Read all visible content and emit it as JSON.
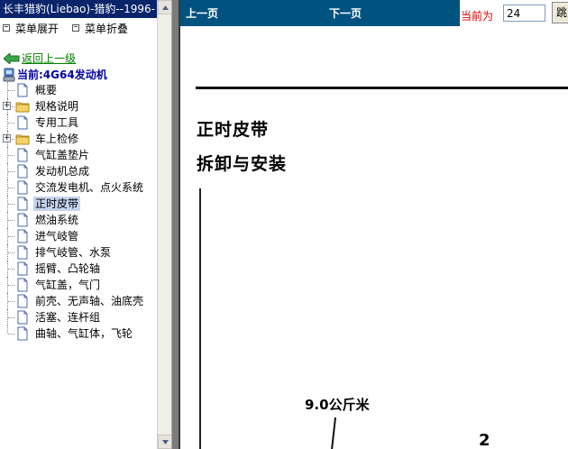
{
  "left": {
    "title": "长丰猎豹(Liebao)-猎豹--1996-",
    "menu_expand": "菜单展开",
    "menu_collapse": "菜单折叠",
    "back_link": "返回上一级",
    "root_label": "当前:4G64发动机",
    "tree": [
      {
        "label": "概要",
        "icon": "page-icon"
      },
      {
        "label": "规格说明",
        "icon": "folder-icon",
        "expandable": true
      },
      {
        "label": "专用工具",
        "icon": "page-icon"
      },
      {
        "label": "车上检修",
        "icon": "folder-icon",
        "expandable": true
      },
      {
        "label": "气缸盖垫片",
        "icon": "page-icon"
      },
      {
        "label": "发动机总成",
        "icon": "page-icon"
      },
      {
        "label": "交流发电机、点火系统",
        "icon": "page-icon"
      },
      {
        "label": "正时皮带",
        "icon": "page-icon",
        "selected": true
      },
      {
        "label": "燃油系统",
        "icon": "page-icon"
      },
      {
        "label": "进气岐管",
        "icon": "page-icon"
      },
      {
        "label": "排气岐管、水泵",
        "icon": "page-icon"
      },
      {
        "label": "摇臂、凸轮轴",
        "icon": "page-icon"
      },
      {
        "label": "气缸盖，气门",
        "icon": "page-icon"
      },
      {
        "label": "前壳、无声轴、油底壳",
        "icon": "page-icon"
      },
      {
        "label": "活塞、连杆组",
        "icon": "page-icon"
      },
      {
        "label": "曲轴、气缸体，飞轮",
        "icon": "page-icon"
      }
    ]
  },
  "nav": {
    "prev": "上一页",
    "next": "下一页",
    "current_label": "当前为",
    "page_value": "24",
    "go_label": "跳"
  },
  "doc": {
    "heading": "正时皮带",
    "subheading": "拆卸与安装",
    "torque": "9.0公斤米",
    "callout": "2"
  },
  "colors": {
    "title_bar": "#0a246a",
    "nav_bar": "#00527f",
    "back_link": "#008000",
    "root_label": "#0000a0",
    "current_label": "#e00000",
    "selected_bg": "#c6d3ef"
  }
}
